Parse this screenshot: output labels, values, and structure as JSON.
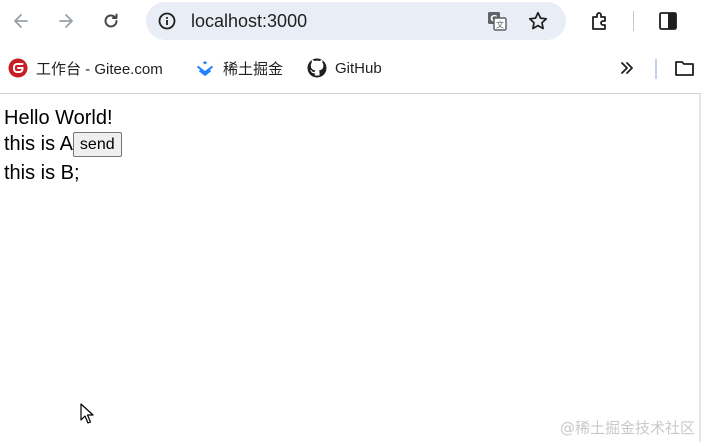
{
  "browser": {
    "url": "localhost:3000",
    "bookmarks": [
      {
        "label": "工作台 - Gitee.com",
        "icon": "gitee-icon"
      },
      {
        "label": "稀土掘金",
        "icon": "juejin-icon"
      },
      {
        "label": "GitHub",
        "icon": "github-icon"
      }
    ]
  },
  "page": {
    "line1": "Hello World!",
    "line2_text": "this is A",
    "send_label": "send",
    "line3": "this is B;"
  },
  "watermark": "@稀土掘金技术社区",
  "colors": {
    "omnibox_bg": "#e9eef6",
    "gitee_red": "#c71d23",
    "juejin_blue": "#1e80ff"
  }
}
